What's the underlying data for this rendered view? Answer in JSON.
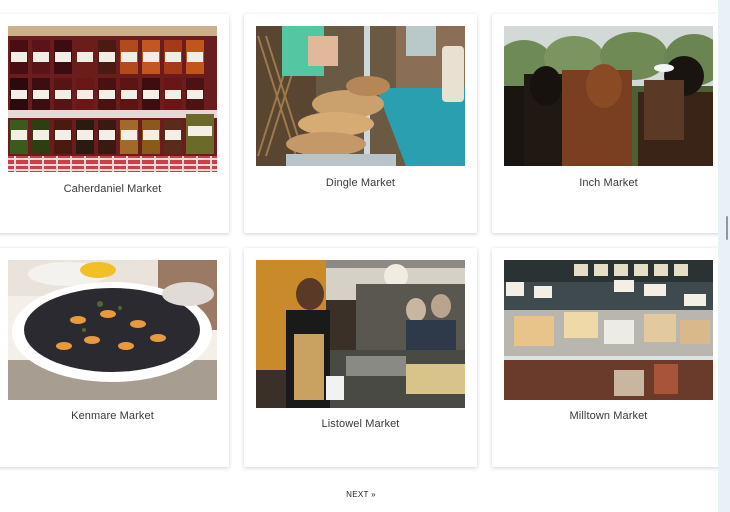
{
  "markets": [
    {
      "name": "Caherdaniel Market",
      "image_alt": "jars of preserves"
    },
    {
      "name": "Dingle Market",
      "image_alt": "bread stall"
    },
    {
      "name": "Inch Market",
      "image_alt": "cattle in a field"
    },
    {
      "name": "Kenmare Market",
      "image_alt": "plate of mussels"
    },
    {
      "name": "Listowel Market",
      "image_alt": "food stall vendor"
    },
    {
      "name": "Milltown Market",
      "image_alt": "cheese counter"
    }
  ],
  "pagination": {
    "next_label": "NEXT »"
  }
}
